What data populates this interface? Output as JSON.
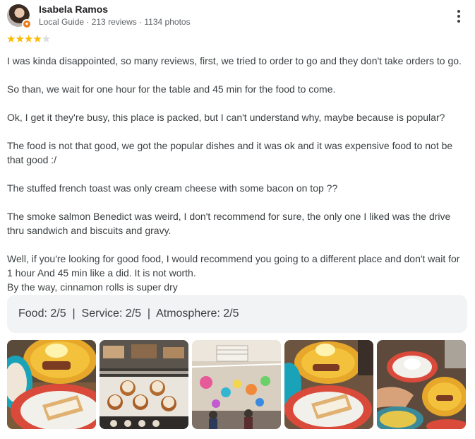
{
  "reviewer": {
    "name": "Isabela Ramos",
    "meta": "Local Guide · 213 reviews · 1134 photos"
  },
  "rating": {
    "stars": 4,
    "max": 5
  },
  "review_text": [
    "I was kinda disappointed, so many reviews, first, we tried to order to go and they don't take orders to go.",
    "So than, we wait for one hour for the table and 45 min for the food to come.",
    "Ok, I get it they're busy, this place is packed, but I can't understand why, maybe because is popular?",
    "The food is not that good, we got the popular dishes and it was ok and it was expensive food to not be that good :/",
    "The stuffed french toast was only cream cheese with some bacon on top ??",
    "The smoke salmon Benedict was weird, I don't recommend for sure, the only one I liked was the drive thru sandwich and biscuits and gravy.",
    "Well, if you're looking for good food, I would recommend you going to a different place and don't wait for 1 hour And 45 min like a did. It is not worth.",
    "By the way, cinnamon rolls is super dry"
  ],
  "ratings_summary": "Food: 2/5  |  Service: 2/5  |  Atmosphere: 2/5",
  "photos": [
    {
      "subject": "food-plates"
    },
    {
      "subject": "cinnamon-rolls-display"
    },
    {
      "subject": "restaurant-interior"
    },
    {
      "subject": "food-plates"
    },
    {
      "subject": "food-plates"
    }
  ],
  "colors": {
    "star_on": "#fbbc04",
    "star_off": "#dadce0",
    "ratings_bg": "#f1f3f4",
    "badge": "#ea7b1a"
  }
}
